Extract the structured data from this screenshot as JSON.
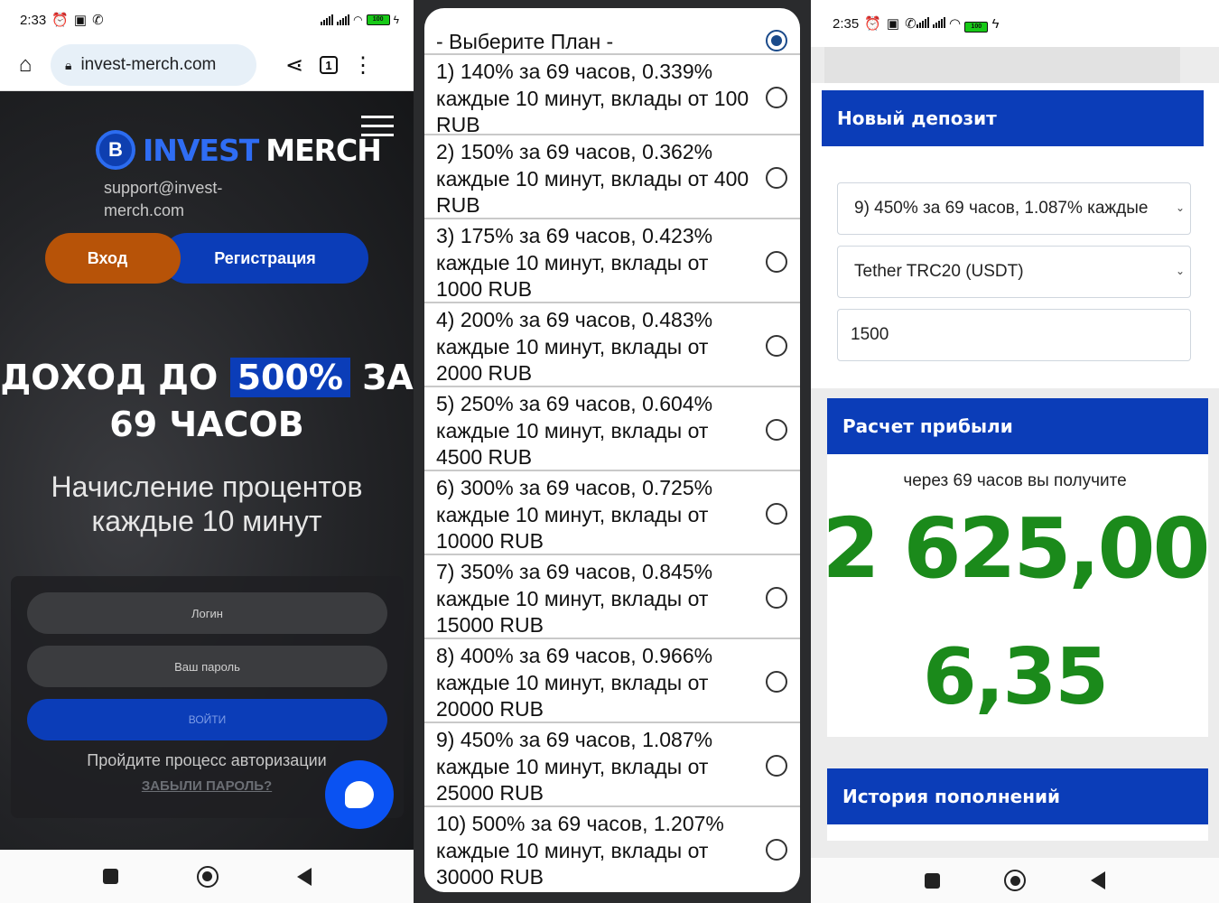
{
  "left": {
    "status": {
      "time": "2:33",
      "battery": "100"
    },
    "browser": {
      "url": "invest-merch.com",
      "tab_count": "1"
    },
    "brand": {
      "name_a": "INVEST",
      "name_b": "MERCH",
      "coin_letter": "B"
    },
    "support_email": "support@invest-merch.com",
    "buttons": {
      "login": "Вход",
      "register": "Регистрация",
      "enter": "ВОЙТИ"
    },
    "headline": {
      "part1": "ДОХОД ДО",
      "highlight": "500%",
      "part2": "ЗА",
      "line2": "69 ЧАСОВ"
    },
    "subheadline": "Начисление процентов каждые 10 минут",
    "form": {
      "login_placeholder": "Логин",
      "password_placeholder": "Ваш пароль"
    },
    "auth_text": "Пройдите процесс авторизации",
    "forgot_link": "ЗАБЫЛИ ПАРОЛЬ?"
  },
  "middle": {
    "header": "- Выберите План -",
    "options": [
      "1) 140% за 69 часов, 0.339% каждые 10 минут, вклады от 100 RUB",
      "2) 150% за 69 часов, 0.362% каждые 10 минут, вклады от 400 RUB",
      "3) 175% за 69 часов, 0.423% каждые 10 минут, вклады от 1000 RUB",
      "4) 200% за 69 часов, 0.483% каждые 10 минут, вклады от 2000 RUB",
      "5) 250% за 69 часов, 0.604% каждые 10 минут, вклады от 4500 RUB",
      "6) 300% за 69 часов, 0.725% каждые 10 минут, вклады от 10000 RUB",
      "7) 350% за 69 часов, 0.845% каждые 10 минут, вклады от 15000 RUB",
      "8) 400% за 69 часов, 0.966% каждые 10 минут, вклады от 20000 RUB",
      "9) 450% за 69 часов, 1.087% каждые 10 минут, вклады от 25000 RUB",
      "10) 500% за 69 часов, 1.207% каждые 10 минут, вклады от 30000 RUB"
    ]
  },
  "right": {
    "status": {
      "time": "2:35",
      "battery": "100"
    },
    "new_deposit": {
      "title": "Новый депозит",
      "plan_value": "9) 450% за 69 часов, 1.087% каждые",
      "currency_value": "Tether TRC20 (USDT)",
      "amount_value": "1500"
    },
    "profit": {
      "title": "Расчет прибыли",
      "caption": "через 69 часов вы получите",
      "total": "2 625,00",
      "per_interval": "6,35"
    },
    "history": {
      "title": "История пополнений"
    }
  },
  "colors": {
    "brand_blue": "#0b3db8",
    "login_orange": "#b75308",
    "profit_green": "#1b8a1b",
    "chat_blue": "#0a52f2"
  }
}
